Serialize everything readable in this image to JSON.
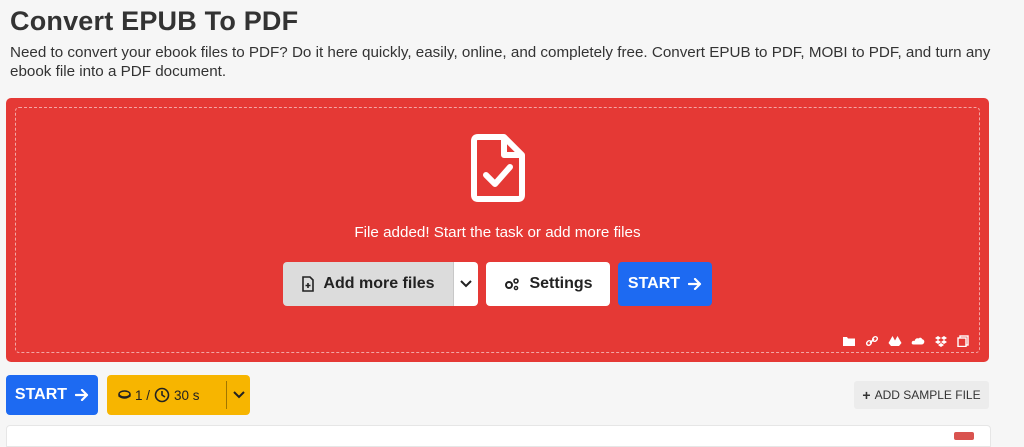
{
  "page": {
    "title": "Convert EPUB To PDF",
    "description": "Need to convert your ebook files to PDF? Do it here quickly, easily, online, and completely free. Convert EPUB to PDF, MOBI to PDF, and turn any ebook file into a PDF document."
  },
  "dropzone": {
    "status": "File added! Start the task or add more files",
    "add_more_label": "Add more files",
    "settings_label": "Settings",
    "start_label": "START",
    "cloud_icons": [
      "folder-icon",
      "link-icon",
      "google-drive-icon",
      "onedrive-icon",
      "dropbox-icon",
      "clipboard-icon"
    ]
  },
  "toolbar": {
    "start_label": "START",
    "credits_count": "1 /",
    "credits_time": "30 s",
    "add_sample_label": "ADD SAMPLE FILE"
  },
  "colors": {
    "dropzone_bg": "#e53935",
    "primary": "#1d6af2",
    "credits_bg": "#f7b500"
  }
}
